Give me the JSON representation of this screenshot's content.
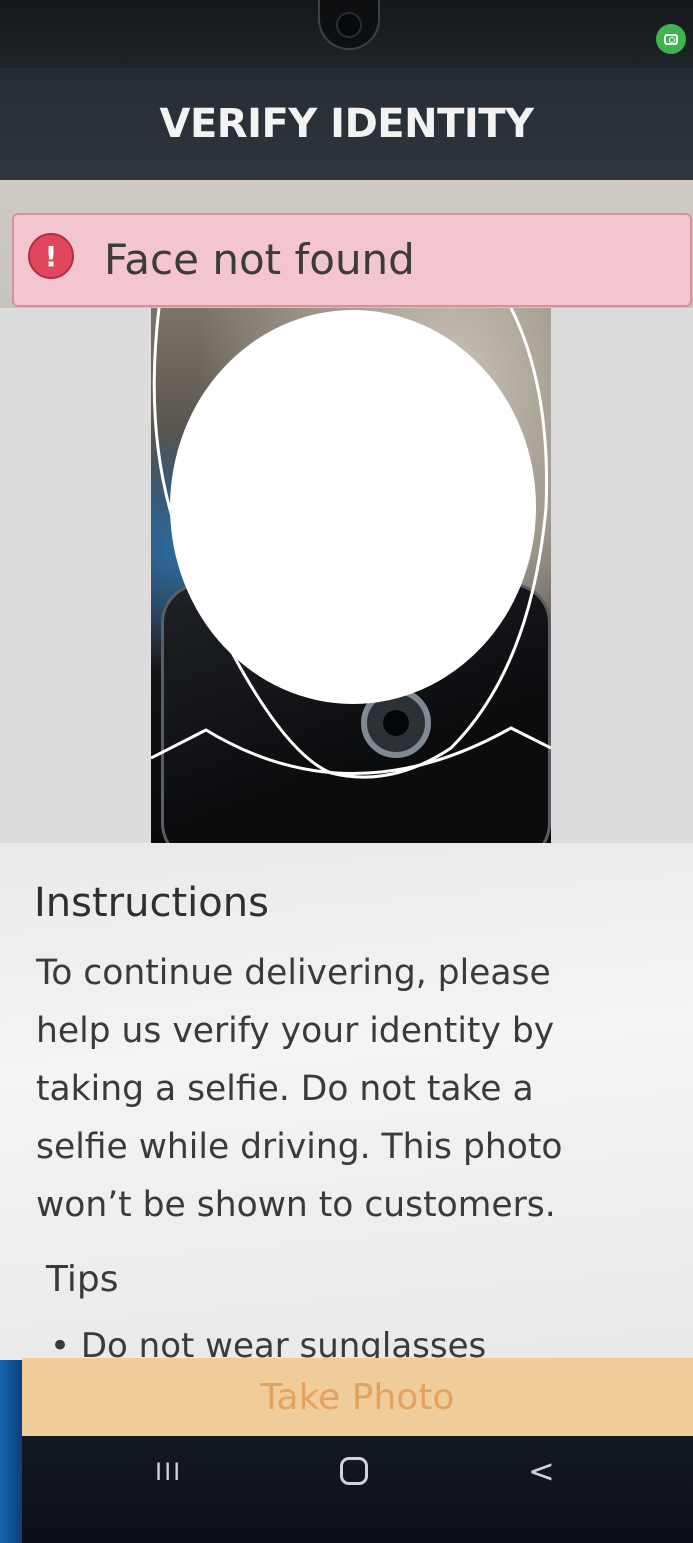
{
  "status_bar": {
    "indicator_icon": "camera-in-use-icon",
    "indicator_color": "#3fb34f"
  },
  "header": {
    "title": "VERIFY IDENTITY"
  },
  "alert": {
    "icon": "alert-circle-icon",
    "message": "Face not found",
    "background": "#f2c5cf",
    "icon_color": "#e0475c"
  },
  "camera": {
    "overlay": "face-oval-guide"
  },
  "instructions": {
    "title": "Instructions",
    "lines": [
      "To continue delivering, please",
      "help us verify your identity by",
      "taking a selfie. Do not take a",
      "selfie while driving. This photo",
      "won’t be shown to customers."
    ]
  },
  "tips": {
    "title": "Tips",
    "items": [
      "• Do not wear sunglasses"
    ]
  },
  "actions": {
    "take_photo": "Take Photo",
    "button_color": "#f0cc9a",
    "label_color": "#e3a35e"
  },
  "system_nav": {
    "recent": "III",
    "back": "<"
  }
}
